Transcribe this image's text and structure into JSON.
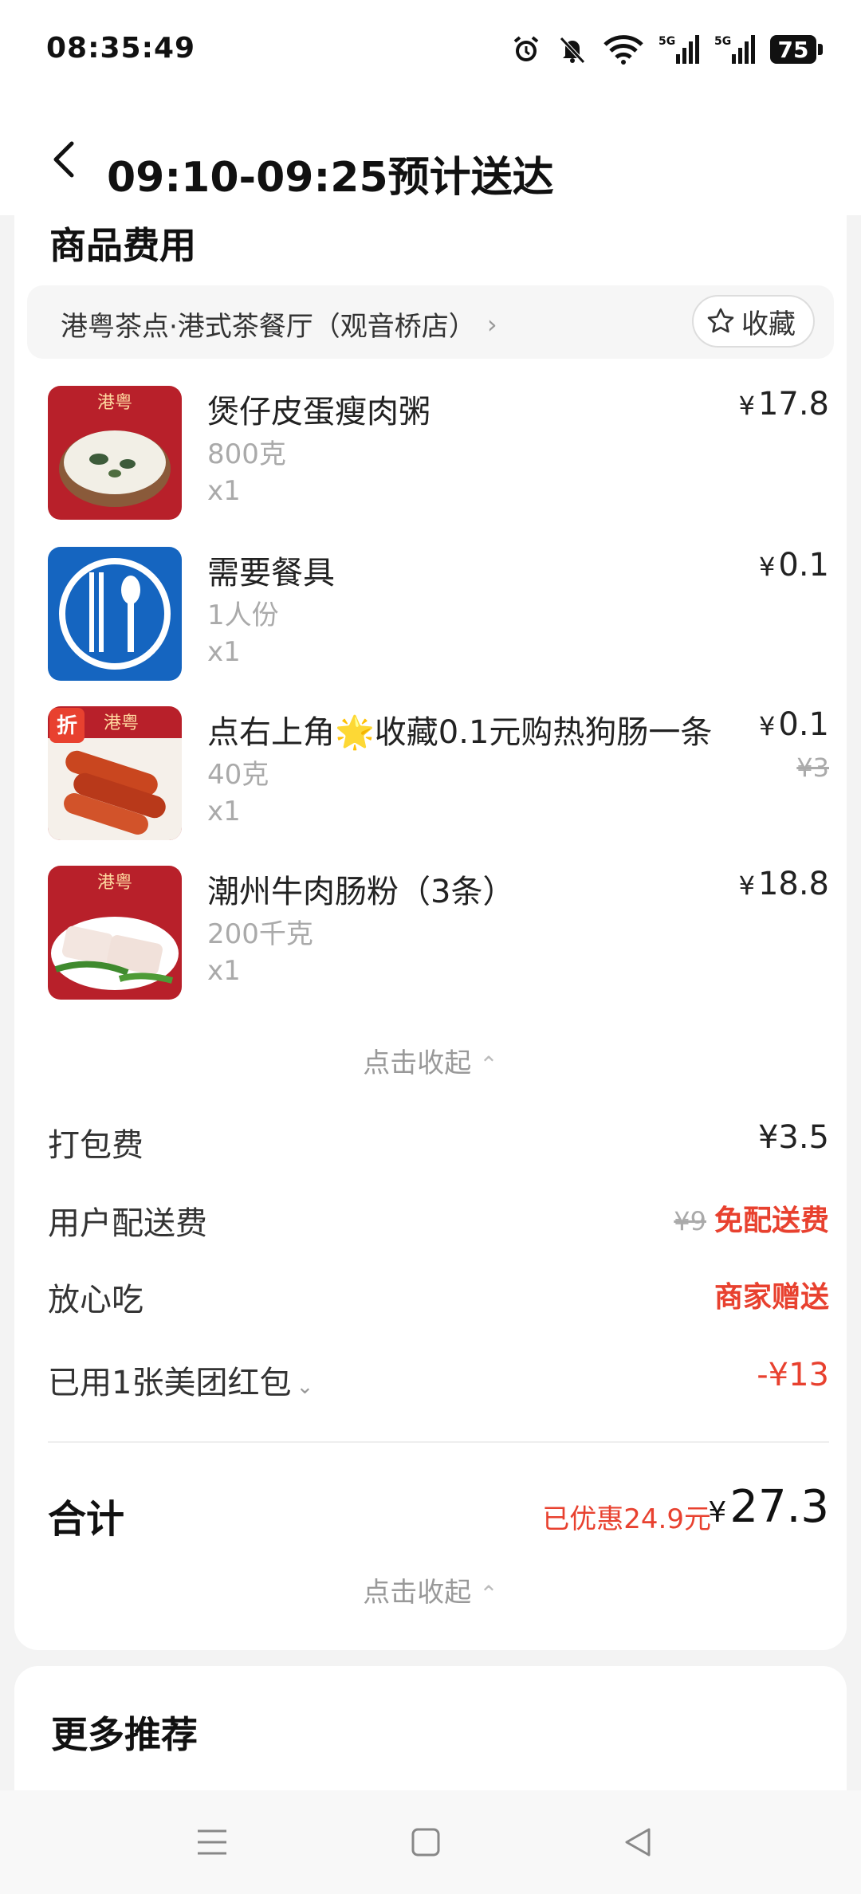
{
  "status_bar": {
    "time": "08:35:49",
    "battery": "75",
    "network": [
      "5G",
      "5G"
    ]
  },
  "header": {
    "title": "09:10-09:25预计送达"
  },
  "section_title": "商品费用",
  "store": {
    "name": "港粤茶点·港式茶餐厅（观音桥店）",
    "favorite_label": "收藏"
  },
  "items": [
    {
      "name": "煲仔皮蛋瘦肉粥",
      "spec": "800克",
      "qty": "x1",
      "price": "17.8",
      "badge": "港粤"
    },
    {
      "name": "需要餐具",
      "spec": "1人份",
      "qty": "x1",
      "price": "0.1"
    },
    {
      "name": "点右上角🌟收藏0.1元购热狗肠一条",
      "spec": "40克",
      "qty": "x1",
      "price": "0.1",
      "original_price": "¥3",
      "badge": "港粤",
      "tag": "折"
    },
    {
      "name": "潮州牛肉肠粉（3条）",
      "spec": "200千克",
      "qty": "x1",
      "price": "18.8",
      "badge": "港粤"
    }
  ],
  "currency": "¥",
  "collapse_label": "点击收起",
  "fees": {
    "packing": {
      "label": "打包费",
      "value": "¥3.5"
    },
    "delivery": {
      "label": "用户配送费",
      "original": "¥9",
      "value": "免配送费"
    },
    "assurance": {
      "label": "放心吃",
      "value": "商家赠送"
    },
    "coupon": {
      "label": "已用1张美团红包",
      "value": "-¥13"
    }
  },
  "total": {
    "label": "合计",
    "discount": "已优惠24.9元",
    "value": "27.3"
  },
  "more_title": "更多推荐",
  "colors": {
    "accent_red": "#e8412f",
    "thumb_red": "#b8202a",
    "thumb_blue": "#1565c0"
  }
}
